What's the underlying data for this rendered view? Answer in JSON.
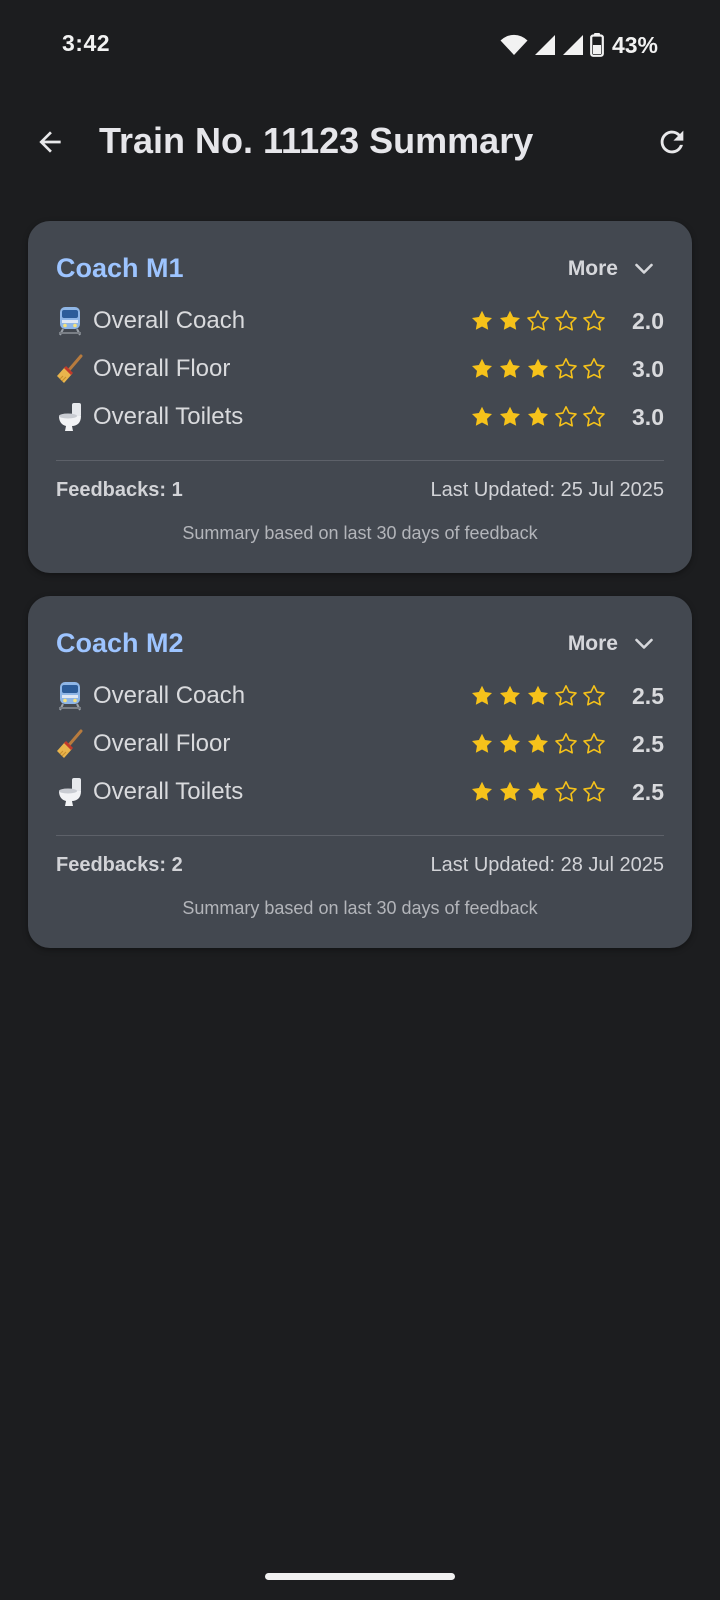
{
  "status_bar": {
    "time": "3:42",
    "battery": "43%"
  },
  "app_bar": {
    "title": "Train No. 11123 Summary",
    "back_icon": "arrow-left-icon",
    "refresh_icon": "refresh-icon"
  },
  "colors": {
    "background": "#1c1d1f",
    "card": "#434850",
    "accent": "#9dc4ff",
    "star": "#f6c21a"
  },
  "coaches": [
    {
      "name": "Coach M1",
      "more_label": "More",
      "ratings": [
        {
          "icon": "train-icon",
          "label": "Overall Coach",
          "stars": 2,
          "value": "2.0"
        },
        {
          "icon": "broom-icon",
          "label": "Overall Floor",
          "stars": 3,
          "value": "3.0"
        },
        {
          "icon": "toilet-icon",
          "label": "Overall Toilets",
          "stars": 3,
          "value": "3.0"
        }
      ],
      "feedbacks": "Feedbacks: 1",
      "last_updated": "Last Updated: 25 Jul 2025",
      "summary_note": "Summary based on last 30 days of feedback"
    },
    {
      "name": "Coach M2",
      "more_label": "More",
      "ratings": [
        {
          "icon": "train-icon",
          "label": "Overall Coach",
          "stars": 3,
          "value": "2.5"
        },
        {
          "icon": "broom-icon",
          "label": "Overall Floor",
          "stars": 3,
          "value": "2.5"
        },
        {
          "icon": "toilet-icon",
          "label": "Overall Toilets",
          "stars": 3,
          "value": "2.5"
        }
      ],
      "feedbacks": "Feedbacks: 2",
      "last_updated": "Last Updated: 28 Jul 2025",
      "summary_note": "Summary based on last 30 days of feedback"
    }
  ]
}
